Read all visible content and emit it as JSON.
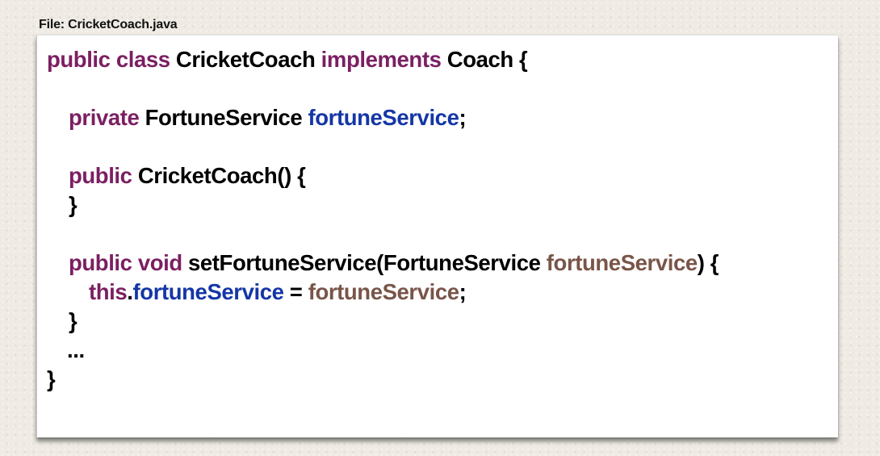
{
  "file_label": "File: CricketCoach.java",
  "colors": {
    "keyword": "#7b1f62",
    "field": "#1436a6",
    "parameter": "#795548",
    "plain": "#000000"
  },
  "code": {
    "line1": {
      "kw_public": "public",
      "kw_class": "class",
      "class_name": "CricketCoach",
      "kw_implements": "implements",
      "iface": "Coach",
      "brace": "{"
    },
    "line2": {
      "kw_private": "private",
      "type": "FortuneService",
      "field": "fortuneService",
      "semicolon": ";"
    },
    "line3": {
      "kw_public": "public",
      "ctor": "CricketCoach()",
      "brace": "{"
    },
    "line4": {
      "brace": "}"
    },
    "line5": {
      "kw_public": "public",
      "kw_void": "void",
      "method": "setFortuneService(FortuneService",
      "param": "fortuneService",
      "close": ")",
      "brace": "{"
    },
    "line6": {
      "kw_this": "this",
      "dot": ".",
      "field": "fortuneService",
      "assign": "=",
      "param": "fortuneService",
      "semicolon": ";"
    },
    "line7": {
      "brace": "}"
    },
    "line8": {
      "ellipsis": "..."
    },
    "line9": {
      "brace": "}"
    }
  }
}
